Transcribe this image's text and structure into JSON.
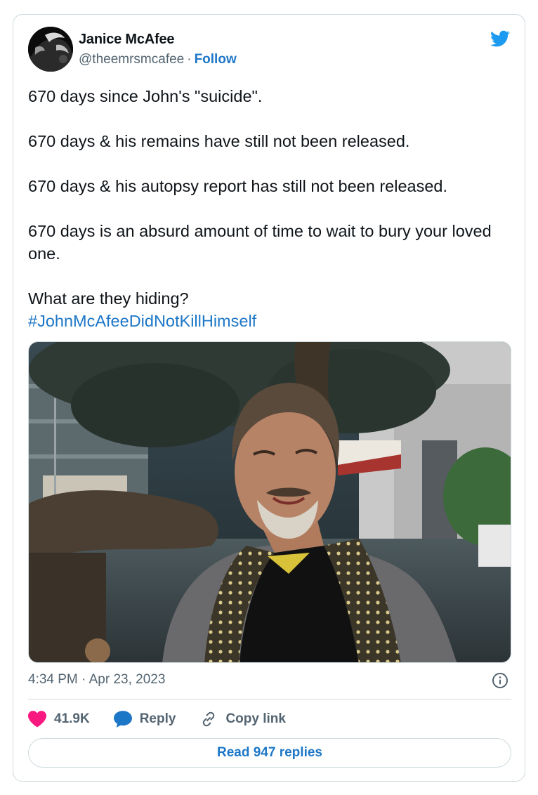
{
  "author": {
    "name": "Janice McAfee",
    "handle": "@theemrsmcafee",
    "separator": "·",
    "follow_label": "Follow"
  },
  "tweet": {
    "paragraphs": [
      "670 days since John's \"suicide\".",
      "670 days & his remains have still not been released.",
      "670 days & his autopsy report has still not been released.",
      "670 days is an absurd amount of time to wait to bury your loved one.",
      "What are they hiding?"
    ],
    "hashtag": "#JohnMcAfeeDidNotKillHimself"
  },
  "meta": {
    "timestamp": "4:34 PM · Apr 23, 2023"
  },
  "actions": {
    "like_count": "41.9K",
    "reply_label": "Reply",
    "copy_link_label": "Copy link"
  },
  "read_replies_label": "Read 947 replies",
  "colors": {
    "accent": "#1d77c7",
    "twitter_blue": "#1d9bf0",
    "like_red": "#f91880",
    "muted_text": "#536471",
    "border": "#cfd9de"
  },
  "icons": {
    "brand": "twitter-bird-icon",
    "info": "info-icon",
    "like": "heart-icon",
    "reply": "speech-bubble-icon",
    "copy": "link-icon"
  }
}
